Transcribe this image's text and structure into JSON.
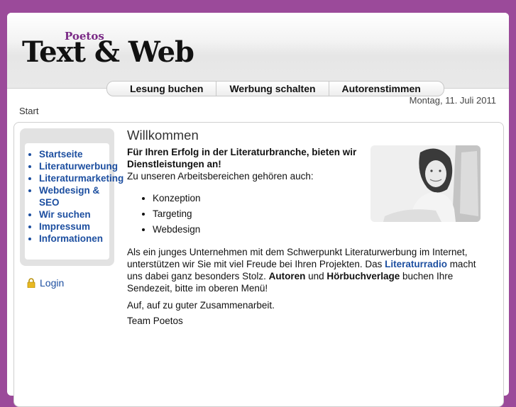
{
  "header": {
    "logo_top": "Poetos",
    "logo_main": "Text & Web"
  },
  "nav": {
    "items": [
      {
        "label": "Lesung buchen"
      },
      {
        "label": "Werbung schalten"
      },
      {
        "label": "Autorenstimmen"
      }
    ]
  },
  "date": "Montag, 11. Juli 2011",
  "breadcrumb": "Start",
  "sidebar": {
    "items": [
      {
        "label": "Startseite"
      },
      {
        "label": "Literaturwerbung"
      },
      {
        "label": "Literaturmarketing"
      },
      {
        "label": "Webdesign &"
      },
      {
        "label": "SEO"
      },
      {
        "label": "Wir suchen"
      },
      {
        "label": "Impressum"
      },
      {
        "label": "Informationen"
      }
    ],
    "login": "Login"
  },
  "main": {
    "title": "Willkommen",
    "intro": "Für Ihren Erfolg in der Literaturbranche, bieten wir Dienstleistungen an!",
    "areas_heading": "Zu unseren Arbeitsbereichen gehören auch:",
    "areas": [
      "Konzeption",
      "Targeting",
      "Webdesign"
    ],
    "para1_a": "Als ein junges Unternehmen mit dem Schwerpunkt Literaturwerbung im Internet, unterstützen wir Sie mit viel Freude bei Ihren Projekten. Das ",
    "para1_link": "Literaturradio",
    "para1_b": " macht uns dabei ganz besonders Stolz. ",
    "para1_bold1": "Autoren",
    "para1_c": " und ",
    "para1_bold2": "Hörbuchverlage",
    "para1_d": " buchen Ihre Sendezeit, bitte im oberen Menü!",
    "para2": "Auf, auf zu guter Zusammenarbeit.",
    "para3": "Team Poetos"
  }
}
